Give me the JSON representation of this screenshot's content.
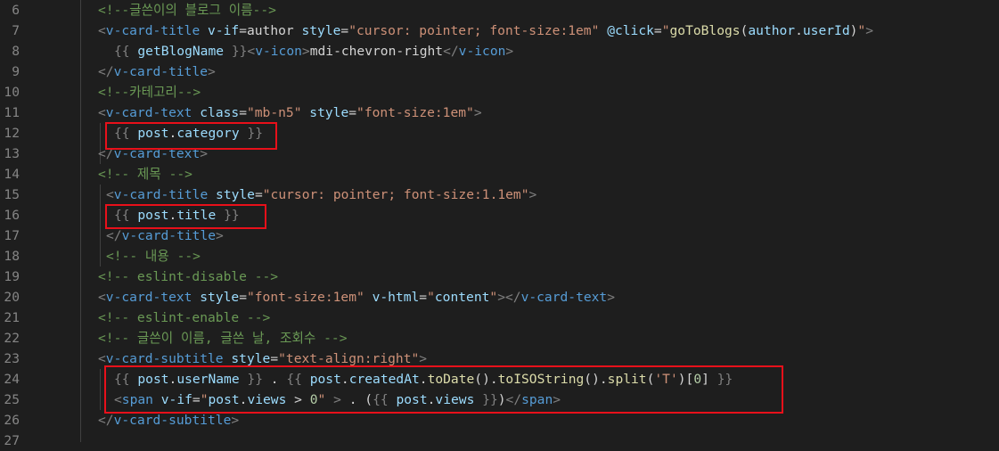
{
  "editor": {
    "theme": {
      "background": "#1e1e1e",
      "highlight_box": "#e8101a"
    },
    "lines": [
      {
        "n": "6",
        "indent": 0,
        "tokens": [
          {
            "c": "c-com",
            "t": "<!--글쓴이의 블로그 이름-->"
          }
        ]
      },
      {
        "n": "7",
        "indent": 0,
        "tokens": [
          {
            "c": "c-br",
            "t": "<"
          },
          {
            "c": "c-tag",
            "t": "v-card-title"
          },
          {
            "c": "c-txt",
            "t": " "
          },
          {
            "c": "c-attr",
            "t": "v-if"
          },
          {
            "c": "c-txt",
            "t": "=author "
          },
          {
            "c": "c-attr",
            "t": "style"
          },
          {
            "c": "c-txt",
            "t": "="
          },
          {
            "c": "c-str",
            "t": "\"cursor: pointer; font-size:1em\""
          },
          {
            "c": "c-txt",
            "t": " "
          },
          {
            "c": "c-attr",
            "t": "@click"
          },
          {
            "c": "c-txt",
            "t": "="
          },
          {
            "c": "c-str",
            "t": "\""
          },
          {
            "c": "c-yel",
            "t": "goToBlogs"
          },
          {
            "c": "c-txt",
            "t": "("
          },
          {
            "c": "c-attr",
            "t": "author"
          },
          {
            "c": "c-txt",
            "t": "."
          },
          {
            "c": "c-attr",
            "t": "userId"
          },
          {
            "c": "c-txt",
            "t": ")"
          },
          {
            "c": "c-str",
            "t": "\""
          },
          {
            "c": "c-br",
            "t": ">"
          }
        ]
      },
      {
        "n": "8",
        "indent": 1,
        "tokens": [
          {
            "c": "c-br",
            "t": "{{"
          },
          {
            "c": "c-txt",
            "t": " "
          },
          {
            "c": "c-attr",
            "t": "getBlogName"
          },
          {
            "c": "c-txt",
            "t": " "
          },
          {
            "c": "c-br",
            "t": "}}"
          },
          {
            "c": "c-br",
            "t": "<"
          },
          {
            "c": "c-tag",
            "t": "v-icon"
          },
          {
            "c": "c-br",
            "t": ">"
          },
          {
            "c": "c-txt",
            "t": "mdi-chevron-right"
          },
          {
            "c": "c-br",
            "t": "</"
          },
          {
            "c": "c-tag",
            "t": "v-icon"
          },
          {
            "c": "c-br",
            "t": ">"
          }
        ]
      },
      {
        "n": "9",
        "indent": 0,
        "tokens": [
          {
            "c": "c-br",
            "t": "</"
          },
          {
            "c": "c-tag",
            "t": "v-card-title"
          },
          {
            "c": "c-br",
            "t": ">"
          }
        ]
      },
      {
        "n": "10",
        "indent": 0,
        "tokens": [
          {
            "c": "c-com",
            "t": "<!--카테고리-->"
          }
        ]
      },
      {
        "n": "11",
        "indent": 0,
        "tokens": [
          {
            "c": "c-br",
            "t": "<"
          },
          {
            "c": "c-tag",
            "t": "v-card-text"
          },
          {
            "c": "c-txt",
            "t": " "
          },
          {
            "c": "c-attr",
            "t": "class"
          },
          {
            "c": "c-txt",
            "t": "="
          },
          {
            "c": "c-str",
            "t": "\"mb-n5\""
          },
          {
            "c": "c-txt",
            "t": " "
          },
          {
            "c": "c-attr",
            "t": "style"
          },
          {
            "c": "c-txt",
            "t": "="
          },
          {
            "c": "c-str",
            "t": "\"font-size:1em\""
          },
          {
            "c": "c-br",
            "t": ">"
          }
        ]
      },
      {
        "n": "12",
        "indent": 1,
        "tokens": [
          {
            "c": "c-br",
            "t": "{{"
          },
          {
            "c": "c-txt",
            "t": " "
          },
          {
            "c": "c-attr",
            "t": "post"
          },
          {
            "c": "c-txt",
            "t": "."
          },
          {
            "c": "c-attr",
            "t": "category"
          },
          {
            "c": "c-txt",
            "t": " "
          },
          {
            "c": "c-br",
            "t": "}}"
          }
        ]
      },
      {
        "n": "13",
        "indent": 0,
        "tokens": [
          {
            "c": "c-br",
            "t": "</"
          },
          {
            "c": "c-tag",
            "t": "v-card-text"
          },
          {
            "c": "c-br",
            "t": ">"
          }
        ]
      },
      {
        "n": "14",
        "indent": 0,
        "tokens": [
          {
            "c": "c-com",
            "t": "<!-- 제목 -->"
          }
        ]
      },
      {
        "n": "15",
        "indent": 0.5,
        "tokens": [
          {
            "c": "c-br",
            "t": "<"
          },
          {
            "c": "c-tag",
            "t": "v-card-title"
          },
          {
            "c": "c-txt",
            "t": " "
          },
          {
            "c": "c-attr",
            "t": "style"
          },
          {
            "c": "c-txt",
            "t": "="
          },
          {
            "c": "c-str",
            "t": "\"cursor: pointer; font-size:1.1em\""
          },
          {
            "c": "c-br",
            "t": ">"
          }
        ]
      },
      {
        "n": "16",
        "indent": 1,
        "tokens": [
          {
            "c": "c-br",
            "t": "{{"
          },
          {
            "c": "c-txt",
            "t": " "
          },
          {
            "c": "c-attr",
            "t": "post"
          },
          {
            "c": "c-txt",
            "t": "."
          },
          {
            "c": "c-attr",
            "t": "title"
          },
          {
            "c": "c-txt",
            "t": " "
          },
          {
            "c": "c-br",
            "t": "}}"
          }
        ]
      },
      {
        "n": "17",
        "indent": 0.5,
        "tokens": [
          {
            "c": "c-br",
            "t": "</"
          },
          {
            "c": "c-tag",
            "t": "v-card-title"
          },
          {
            "c": "c-br",
            "t": ">"
          }
        ]
      },
      {
        "n": "18",
        "indent": 0.5,
        "tokens": [
          {
            "c": "c-com",
            "t": "<!-- 내용 -->"
          }
        ]
      },
      {
        "n": "19",
        "indent": 0,
        "tokens": [
          {
            "c": "c-com",
            "t": "<!-- eslint-disable -->"
          }
        ]
      },
      {
        "n": "20",
        "indent": 0,
        "tokens": [
          {
            "c": "c-br",
            "t": "<"
          },
          {
            "c": "c-tag",
            "t": "v-card-text"
          },
          {
            "c": "c-txt",
            "t": " "
          },
          {
            "c": "c-attr",
            "t": "style"
          },
          {
            "c": "c-txt",
            "t": "="
          },
          {
            "c": "c-str",
            "t": "\"font-size:1em\""
          },
          {
            "c": "c-txt",
            "t": " "
          },
          {
            "c": "c-attr",
            "t": "v-html"
          },
          {
            "c": "c-txt",
            "t": "="
          },
          {
            "c": "c-str",
            "t": "\""
          },
          {
            "c": "c-attr",
            "t": "content"
          },
          {
            "c": "c-str",
            "t": "\""
          },
          {
            "c": "c-br",
            "t": "></"
          },
          {
            "c": "c-tag",
            "t": "v-card-text"
          },
          {
            "c": "c-br",
            "t": ">"
          }
        ]
      },
      {
        "n": "21",
        "indent": 0,
        "tokens": [
          {
            "c": "c-com",
            "t": "<!-- eslint-enable -->"
          }
        ]
      },
      {
        "n": "22",
        "indent": 0,
        "tokens": [
          {
            "c": "c-com",
            "t": "<!-- 글쓴이 이름, 글쓴 날, 조회수 -->"
          }
        ]
      },
      {
        "n": "23",
        "indent": 0,
        "tokens": [
          {
            "c": "c-br",
            "t": "<"
          },
          {
            "c": "c-tag",
            "t": "v-card-subtitle"
          },
          {
            "c": "c-txt",
            "t": " "
          },
          {
            "c": "c-attr",
            "t": "style"
          },
          {
            "c": "c-txt",
            "t": "="
          },
          {
            "c": "c-str",
            "t": "\"text-align:right\""
          },
          {
            "c": "c-br",
            "t": ">"
          }
        ]
      },
      {
        "n": "24",
        "indent": 1,
        "tokens": [
          {
            "c": "c-br",
            "t": "{{"
          },
          {
            "c": "c-txt",
            "t": " "
          },
          {
            "c": "c-attr",
            "t": "post"
          },
          {
            "c": "c-txt",
            "t": "."
          },
          {
            "c": "c-attr",
            "t": "userName"
          },
          {
            "c": "c-txt",
            "t": " "
          },
          {
            "c": "c-br",
            "t": "}}"
          },
          {
            "c": "c-txt",
            "t": " . "
          },
          {
            "c": "c-br",
            "t": "{{"
          },
          {
            "c": "c-txt",
            "t": " "
          },
          {
            "c": "c-attr",
            "t": "post"
          },
          {
            "c": "c-txt",
            "t": "."
          },
          {
            "c": "c-attr",
            "t": "createdAt"
          },
          {
            "c": "c-txt",
            "t": "."
          },
          {
            "c": "c-yel",
            "t": "toDate"
          },
          {
            "c": "c-txt",
            "t": "()."
          },
          {
            "c": "c-yel",
            "t": "toISOString"
          },
          {
            "c": "c-txt",
            "t": "()."
          },
          {
            "c": "c-yel",
            "t": "split"
          },
          {
            "c": "c-txt",
            "t": "("
          },
          {
            "c": "c-str",
            "t": "'T'"
          },
          {
            "c": "c-txt",
            "t": ")["
          },
          {
            "c": "c-num",
            "t": "0"
          },
          {
            "c": "c-txt",
            "t": "] "
          },
          {
            "c": "c-br",
            "t": "}}"
          }
        ]
      },
      {
        "n": "25",
        "indent": 1,
        "tokens": [
          {
            "c": "c-br",
            "t": "<"
          },
          {
            "c": "c-tag",
            "t": "span"
          },
          {
            "c": "c-txt",
            "t": " "
          },
          {
            "c": "c-attr",
            "t": "v-if"
          },
          {
            "c": "c-txt",
            "t": "="
          },
          {
            "c": "c-str",
            "t": "\""
          },
          {
            "c": "c-attr",
            "t": "post"
          },
          {
            "c": "c-txt",
            "t": "."
          },
          {
            "c": "c-attr",
            "t": "views"
          },
          {
            "c": "c-txt",
            "t": " > "
          },
          {
            "c": "c-num",
            "t": "0"
          },
          {
            "c": "c-str",
            "t": "\""
          },
          {
            "c": "c-txt",
            "t": " "
          },
          {
            "c": "c-br",
            "t": ">"
          },
          {
            "c": "c-txt",
            "t": " . ("
          },
          {
            "c": "c-br",
            "t": "{{"
          },
          {
            "c": "c-txt",
            "t": " "
          },
          {
            "c": "c-attr",
            "t": "post"
          },
          {
            "c": "c-txt",
            "t": "."
          },
          {
            "c": "c-attr",
            "t": "views"
          },
          {
            "c": "c-txt",
            "t": " "
          },
          {
            "c": "c-br",
            "t": "}}"
          },
          {
            "c": "c-txt",
            "t": ")"
          },
          {
            "c": "c-br",
            "t": "</"
          },
          {
            "c": "c-tag",
            "t": "span"
          },
          {
            "c": "c-br",
            "t": ">"
          }
        ]
      },
      {
        "n": "26",
        "indent": 0,
        "tokens": [
          {
            "c": "c-br",
            "t": "</"
          },
          {
            "c": "c-tag",
            "t": "v-card-subtitle"
          },
          {
            "c": "c-br",
            "t": ">"
          }
        ]
      },
      {
        "n": "27",
        "indent": 0,
        "tokens": []
      }
    ]
  }
}
